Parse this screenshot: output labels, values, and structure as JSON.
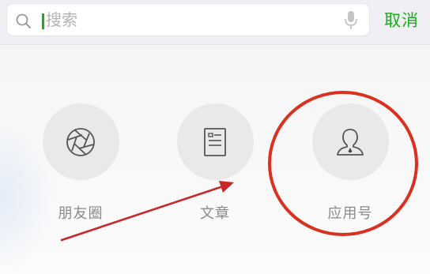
{
  "search": {
    "placeholder": "搜索",
    "value": "",
    "cancel_label": "取消"
  },
  "categories": [
    {
      "label": "朋友圈",
      "icon": "aperture-icon"
    },
    {
      "label": "文章",
      "icon": "article-icon"
    },
    {
      "label": "应用号",
      "icon": "person-icon"
    }
  ],
  "colors": {
    "accent": "#1aad19",
    "circle_bg": "#e9e9ea",
    "label": "#8a8a8a",
    "annotation_red": "#d9301f"
  }
}
